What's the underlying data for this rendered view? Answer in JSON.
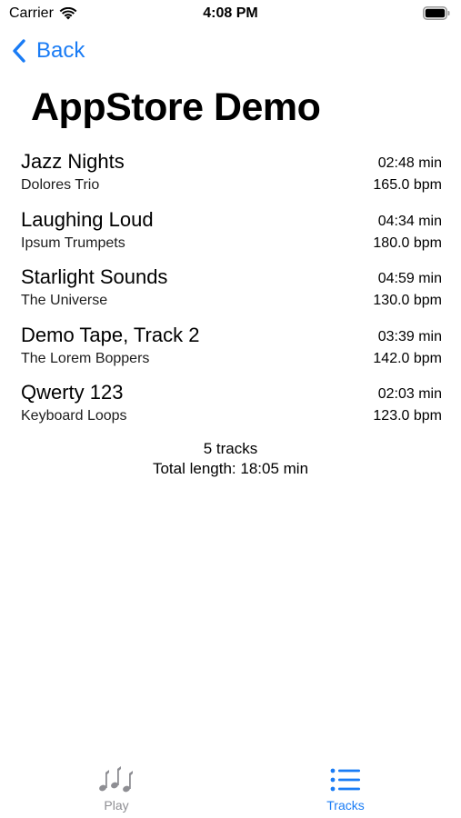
{
  "status_bar": {
    "carrier": "Carrier",
    "time": "4:08 PM",
    "wifi_icon": "wifi-icon",
    "battery_icon": "battery-icon"
  },
  "nav": {
    "back_label": "Back",
    "back_icon": "chevron-left-icon"
  },
  "page": {
    "title": "AppStore Demo"
  },
  "tracks": [
    {
      "title": "Jazz Nights",
      "artist": "Dolores Trio",
      "duration": "02:48 min",
      "bpm": "165.0 bpm"
    },
    {
      "title": "Laughing Loud",
      "artist": "Ipsum Trumpets",
      "duration": "04:34 min",
      "bpm": "180.0 bpm"
    },
    {
      "title": "Starlight Sounds",
      "artist": "The Universe",
      "duration": "04:59 min",
      "bpm": "130.0 bpm"
    },
    {
      "title": "Demo Tape, Track 2",
      "artist": "The Lorem Boppers",
      "duration": "03:39 min",
      "bpm": "142.0 bpm"
    },
    {
      "title": "Qwerty 123",
      "artist": "Keyboard Loops",
      "duration": "02:03 min",
      "bpm": "123.0 bpm"
    }
  ],
  "summary": {
    "count": "5 tracks",
    "total": "Total length: 18:05 min"
  },
  "tab_bar": {
    "tabs": [
      {
        "label": "Play",
        "icon": "music-notes-icon",
        "selected": false
      },
      {
        "label": "Tracks",
        "icon": "list-icon",
        "selected": true
      }
    ]
  },
  "colors": {
    "accent": "#1a7cf5",
    "inactive": "#8e8e93",
    "text": "#000000",
    "background": "#ffffff"
  }
}
